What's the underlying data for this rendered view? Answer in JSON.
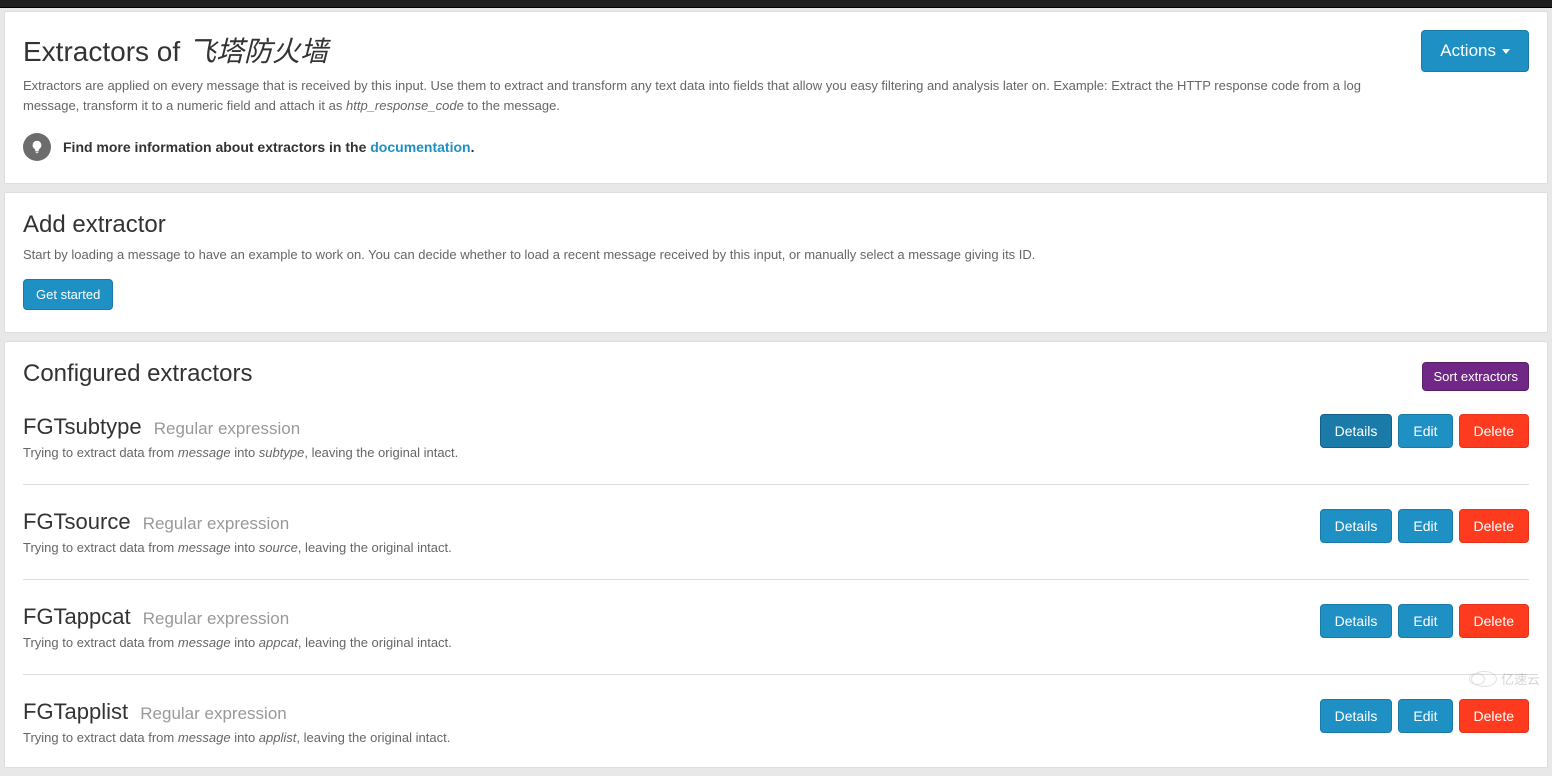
{
  "header": {
    "title_prefix": "Extractors of ",
    "title_name": "飞塔防火墙",
    "description_1": "Extractors are applied on every message that is received by this input. Use them to extract and transform any text data into fields that allow you easy filtering and analysis later on. Example: Extract the HTTP response code from a log message, transform it to a numeric field and attach it as ",
    "description_em": "http_response_code",
    "description_2": " to the message.",
    "actions_label": "Actions",
    "info_prefix": "Find more information about extractors in the ",
    "info_link": "documentation",
    "info_suffix": "."
  },
  "add": {
    "title": "Add extractor",
    "description": "Start by loading a message to have an example to work on. You can decide whether to load a recent message received by this input, or manually select a message giving its ID.",
    "button": "Get started"
  },
  "configured": {
    "title": "Configured extractors",
    "sort_button": "Sort extractors",
    "type_label": "Regular expression",
    "desc_prefix": "Trying to extract data from ",
    "desc_from": "message",
    "desc_into": " into ",
    "desc_suffix": ", leaving the original intact.",
    "details_label": "Details",
    "edit_label": "Edit",
    "delete_label": "Delete",
    "items": [
      {
        "name": "FGTsubtype",
        "target": "subtype",
        "details_active": true
      },
      {
        "name": "FGTsource",
        "target": "source",
        "details_active": false
      },
      {
        "name": "FGTappcat",
        "target": "appcat",
        "details_active": false
      },
      {
        "name": "FGTapplist",
        "target": "applist",
        "details_active": false
      }
    ]
  },
  "watermark": "亿速云"
}
